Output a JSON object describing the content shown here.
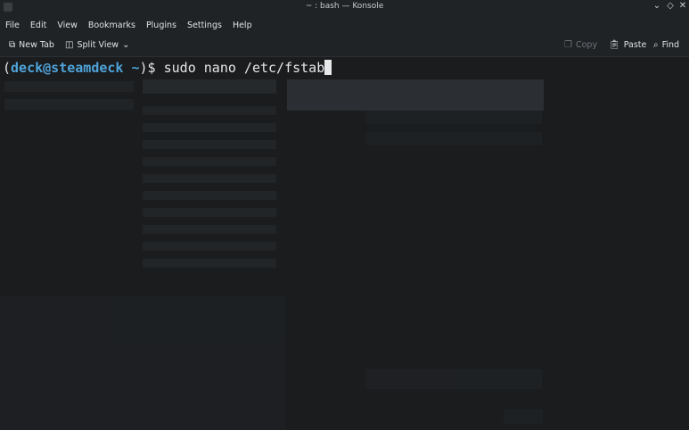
{
  "window": {
    "title": "~ : bash — Konsole"
  },
  "menu": [
    "File",
    "Edit",
    "View",
    "Bookmarks",
    "Plugins",
    "Settings",
    "Help"
  ],
  "toolbar": {
    "new_tab": "New Tab",
    "split_view": "Split View",
    "copy": "Copy",
    "paste": "Paste",
    "find": "Find"
  },
  "terminal": {
    "open_paren": "(",
    "user_host": "deck@steamdeck",
    "dir": "~",
    "close": ")$ ",
    "command": "sudo nano /etc/fstab"
  }
}
